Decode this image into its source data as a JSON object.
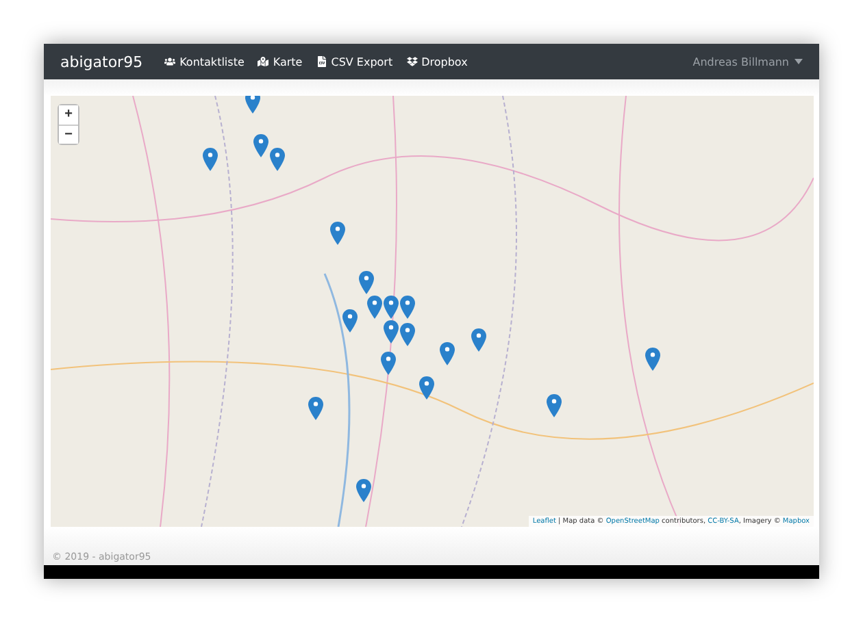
{
  "navbar": {
    "brand": "abigator95",
    "items": [
      {
        "kind": "users",
        "label": "Kontaktliste"
      },
      {
        "kind": "map",
        "label": "Karte"
      },
      {
        "kind": "file",
        "label": "CSV Export"
      },
      {
        "kind": "dropbox",
        "label": "Dropbox"
      }
    ],
    "user": {
      "label": "Andreas Billmann",
      "expanded": false
    }
  },
  "map": {
    "zoom_controls": [
      "+",
      "−"
    ],
    "attribution": [
      {
        "kind": "link",
        "text": "Leaflet"
      },
      {
        "kind": "text",
        "text": " | Map data © "
      },
      {
        "kind": "link",
        "text": "OpenStreetMap"
      },
      {
        "kind": "text",
        "text": " contributors, "
      },
      {
        "kind": "link",
        "text": "CC-BY-SA"
      },
      {
        "kind": "text",
        "text": ", Imagery © "
      },
      {
        "kind": "link",
        "text": "Mapbox"
      }
    ]
  },
  "footer": {
    "text": "© 2019 - abigator95"
  }
}
